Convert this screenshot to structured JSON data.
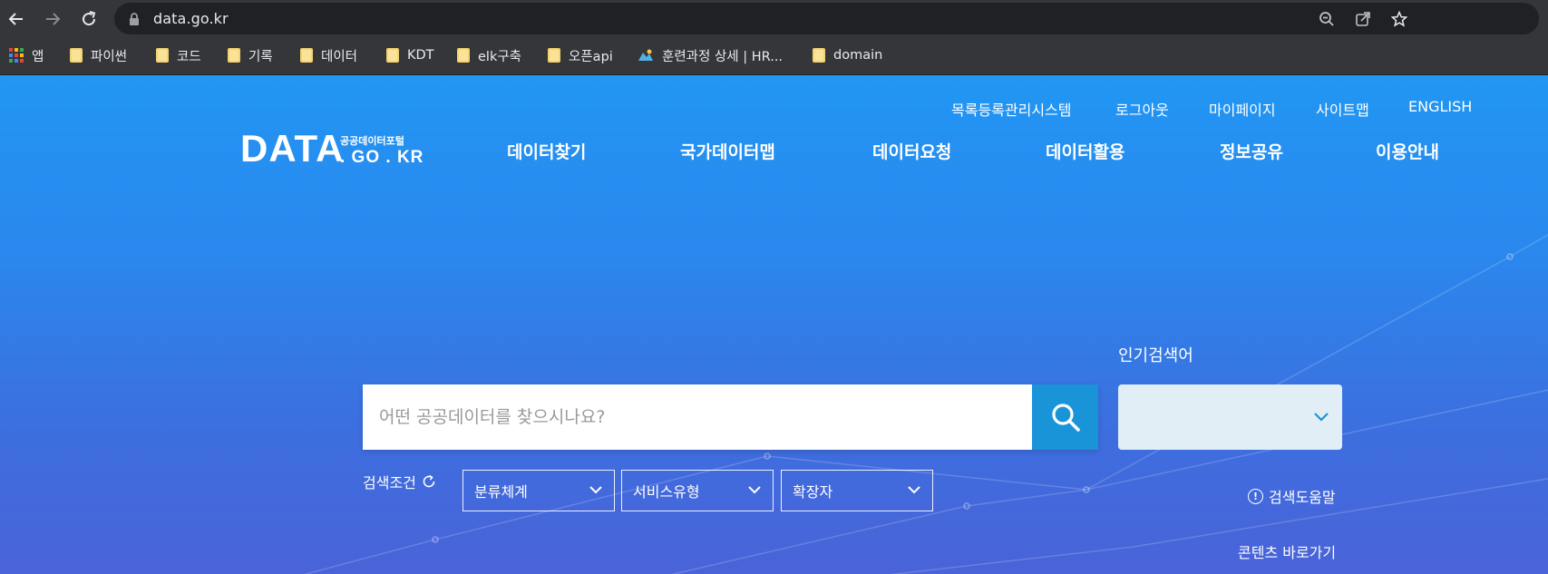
{
  "browser": {
    "url": "data.go.kr",
    "bookmarks": [
      {
        "label": "앱",
        "icon": "apps-grid-icon"
      },
      {
        "label": "파이썬",
        "icon": "folder-icon"
      },
      {
        "label": "코드",
        "icon": "folder-icon"
      },
      {
        "label": "기록",
        "icon": "folder-icon"
      },
      {
        "label": "데이터",
        "icon": "folder-icon"
      },
      {
        "label": "KDT",
        "icon": "folder-icon"
      },
      {
        "label": "elk구축",
        "icon": "folder-icon"
      },
      {
        "label": "오픈api",
        "icon": "folder-icon"
      },
      {
        "label": "훈련과정 상세 | HR...",
        "icon": "site-favicon-icon"
      },
      {
        "label": "domain",
        "icon": "folder-icon"
      }
    ]
  },
  "header": {
    "util_links": [
      "목록등록관리시스템",
      "로그아웃",
      "마이페이지",
      "사이트맵",
      "ENGLISH"
    ],
    "logo": {
      "main": "DATA",
      "sub": "공공데이터포털",
      "domain": ". GO . KR"
    },
    "gnb": [
      "데이터찾기",
      "국가데이터맵",
      "데이터요청",
      "데이터활용",
      "정보공유",
      "이용안내"
    ]
  },
  "search": {
    "placeholder": "어떤 공공데이터를 찾으시나요?",
    "popular_label": "인기검색어",
    "condition_label": "검색조건",
    "filters": [
      "분류체계",
      "서비스유형",
      "확장자"
    ],
    "help_label": "검색도움말",
    "content_link": "콘텐츠 바로가기"
  },
  "colors": {
    "page_top": "#2196f3",
    "page_bottom": "#4a63d8",
    "search_button": "#1a94d9",
    "popular_select": "#e1eef6"
  }
}
